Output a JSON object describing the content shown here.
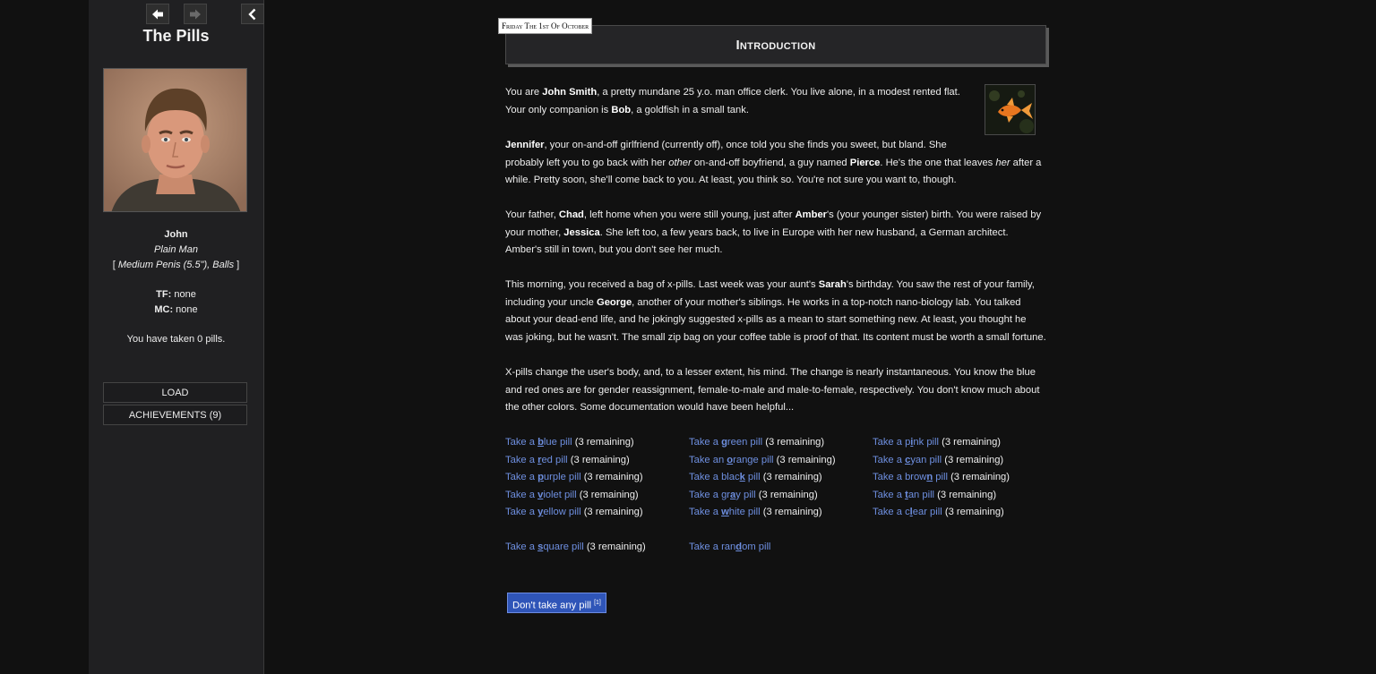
{
  "sidebar": {
    "title": "The Pills",
    "back_icon": "arrow-left-icon",
    "forward_icon": "arrow-right-icon",
    "collapse_icon": "chevron-left-icon",
    "character": {
      "name": "John",
      "class": "Plain Man",
      "body_bracket_open": "[ ",
      "body": "Medium Penis (5.5\"), Balls",
      "body_bracket_close": " ]",
      "tf_label": "TF:",
      "tf_value": " none",
      "mc_label": "MC:",
      "mc_value": " none",
      "pills_taken": "You have taken 0 pills."
    },
    "menu": {
      "load": "LOAD",
      "achievements": "ACHIEVEMENTS (9)"
    }
  },
  "passage": {
    "date": "Friday The 1st Of October",
    "title": "Introduction"
  },
  "paragraphs": [
    [
      {
        "t": "You are "
      },
      {
        "t": "John Smith",
        "b": true
      },
      {
        "t": ", a pretty mundane 25 y.o. man office clerk. You live alone, in a modest rented flat."
      },
      {
        "br": true
      },
      {
        "t": "Your only companion is "
      },
      {
        "t": "Bob",
        "b": true
      },
      {
        "t": ", a goldfish in a small tank."
      }
    ],
    [
      {
        "t": "Jennifer",
        "b": true
      },
      {
        "t": ", your on-and-off girlfriend (currently off), once told you she finds you sweet, but bland. She"
      },
      {
        "br": true
      },
      {
        "t": "probably left you to go back with her "
      },
      {
        "t": "other",
        "i": true
      },
      {
        "t": " on-and-off boyfriend, a guy named "
      },
      {
        "t": "Pierce",
        "b": true
      },
      {
        "t": ". He's the one that leaves "
      },
      {
        "t": "her",
        "i": true
      },
      {
        "t": " after a"
      },
      {
        "br": true
      },
      {
        "t": "while. Pretty soon, she'll come back to you. At least, you think so. You're not sure you want to, though."
      }
    ],
    [
      {
        "t": "Your father, "
      },
      {
        "t": "Chad",
        "b": true
      },
      {
        "t": ", left home when you were still young, just after "
      },
      {
        "t": "Amber",
        "b": true
      },
      {
        "t": "'s (your younger sister) birth. You were raised by"
      },
      {
        "br": true
      },
      {
        "t": "your mother, "
      },
      {
        "t": "Jessica",
        "b": true
      },
      {
        "t": ". She left too, a few years back, to live in Europe with her new husband, a German architect."
      },
      {
        "br": true
      },
      {
        "t": "Amber's still in town, but you don't see her much."
      }
    ],
    [
      {
        "t": "This morning, you received a bag of x-pills. Last week was your aunt's "
      },
      {
        "t": "Sarah",
        "b": true
      },
      {
        "t": "'s birthday. You saw the rest of your family,"
      },
      {
        "br": true
      },
      {
        "t": "including your uncle "
      },
      {
        "t": "George",
        "b": true
      },
      {
        "t": ", another of your mother's siblings. He works in a top-notch nano-biology lab. You talked"
      },
      {
        "br": true
      },
      {
        "t": "about your dead-end life, and he jokingly suggested x-pills as a mean to start something new. At least, you thought he"
      },
      {
        "br": true
      },
      {
        "t": "was joking, but he wasn't. The small zip bag on your coffee table is proof of that. Its content must be worth a small fortune."
      }
    ],
    [
      {
        "t": "X-pills change the user's body, and, to a lesser extent, his mind. The change is nearly instantaneous. You know the blue"
      },
      {
        "br": true
      },
      {
        "t": "and red ones are for gender reassignment, female-to-male and male-to-female, respectively. You don't know much about"
      },
      {
        "br": true
      },
      {
        "t": "the other colors. Some documentation would have been helpful..."
      }
    ]
  ],
  "pill_columns": [
    [
      {
        "pre": "Take a ",
        "hk": "b",
        "post": "lue pill",
        "rem": " (3 remaining)"
      },
      {
        "pre": "Take a ",
        "hk": "r",
        "post": "ed pill",
        "rem": " (3 remaining)"
      },
      {
        "pre": "Take a ",
        "hk": "p",
        "post": "urple pill",
        "rem": " (3 remaining)"
      },
      {
        "pre": "Take a ",
        "hk": "v",
        "post": "iolet pill",
        "rem": " (3 remaining)"
      },
      {
        "pre": "Take a ",
        "hk": "y",
        "post": "ellow pill",
        "rem": " (3 remaining)"
      }
    ],
    [
      {
        "pre": "Take a ",
        "hk": "g",
        "post": "reen pill",
        "rem": " (3 remaining)"
      },
      {
        "pre": "Take an ",
        "hk": "o",
        "post": "range pill",
        "rem": " (3 remaining)"
      },
      {
        "pre": "Take a blac",
        "hk": "k",
        "post": " pill",
        "rem": " (3 remaining)"
      },
      {
        "pre": "Take a gr",
        "hk": "a",
        "post": "y pill",
        "rem": " (3 remaining)"
      },
      {
        "pre": "Take a ",
        "hk": "w",
        "post": "hite pill",
        "rem": " (3 remaining)"
      }
    ],
    [
      {
        "pre": "Take a p",
        "hk": "i",
        "post": "nk pill",
        "rem": " (3 remaining)"
      },
      {
        "pre": "Take a ",
        "hk": "c",
        "post": "yan pill",
        "rem": " (3 remaining)"
      },
      {
        "pre": "Take a brow",
        "hk": "n",
        "post": " pill",
        "rem": " (3 remaining)"
      },
      {
        "pre": "Take a ",
        "hk": "t",
        "post": "an pill",
        "rem": " (3 remaining)"
      },
      {
        "pre": "Take a c",
        "hk": "l",
        "post": "ear pill",
        "rem": " (3 remaining)"
      }
    ]
  ],
  "extra_pills": {
    "square": {
      "pre": "Take a ",
      "hk": "s",
      "post": "quare pill",
      "rem": " (3 remaining)"
    },
    "random": {
      "pre": "Take a ran",
      "hk": "d",
      "post": "om pill",
      "rem": ""
    }
  },
  "no_pill_button": {
    "label": "Don't take any pill ",
    "sup": "[1]"
  },
  "colors": {
    "background": "#111111",
    "sidebar_bg": "#202022",
    "link": "#6e8fe0",
    "button_bg": "#2f55b8"
  }
}
